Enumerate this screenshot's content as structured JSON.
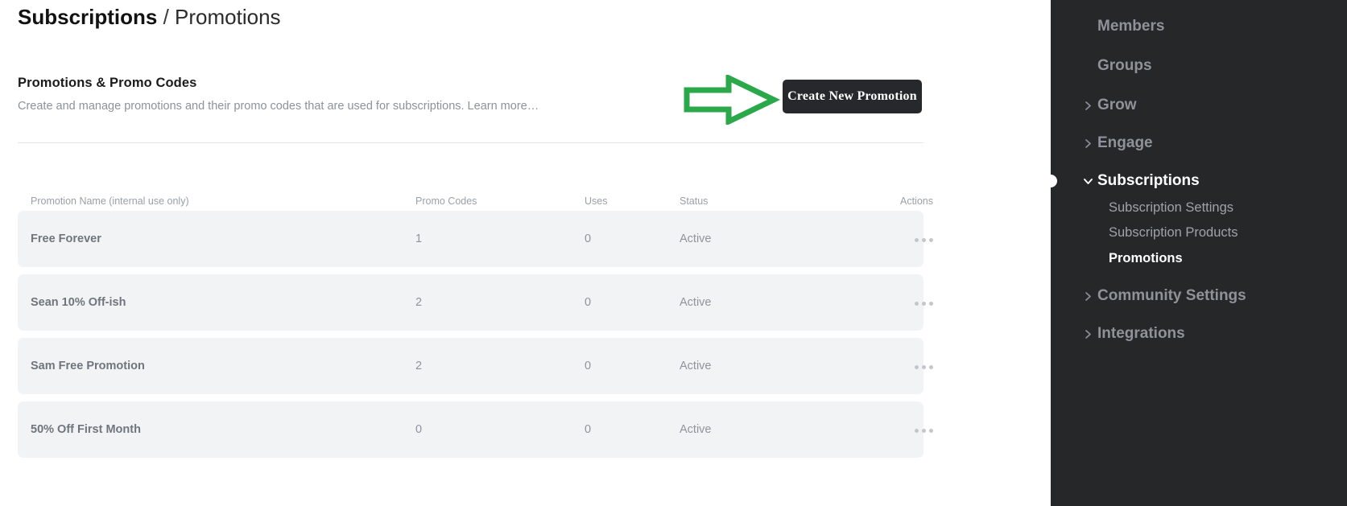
{
  "breadcrumb": {
    "parent": "Subscriptions",
    "separator": " / ",
    "current": "Promotions"
  },
  "section": {
    "title": "Promotions & Promo Codes",
    "subtitle": "Create and manage promotions and their promo codes that are used for subscriptions. Learn more…",
    "create_button_label": "Create New Promotion"
  },
  "annotation": {
    "type": "arrow-right",
    "color": "#2aa84a",
    "points_to": "create-new-promotion-button"
  },
  "table": {
    "headers": {
      "name": "Promotion Name (internal use only)",
      "promo_codes": "Promo Codes",
      "uses": "Uses",
      "status": "Status",
      "actions": "Actions"
    },
    "rows": [
      {
        "name": "Free Forever",
        "promo_codes": "1",
        "uses": "0",
        "status": "Active"
      },
      {
        "name": "Sean 10% Off-ish",
        "promo_codes": "2",
        "uses": "0",
        "status": "Active"
      },
      {
        "name": "Sam Free Promotion",
        "promo_codes": "2",
        "uses": "0",
        "status": "Active"
      },
      {
        "name": "50% Off First Month",
        "promo_codes": "0",
        "uses": "0",
        "status": "Active"
      }
    ]
  },
  "sidebar": {
    "items": [
      {
        "label": "Members",
        "chevron": "none",
        "active": false
      },
      {
        "label": "Groups",
        "chevron": "none",
        "active": false
      },
      {
        "label": "Grow",
        "chevron": "right",
        "active": false
      },
      {
        "label": "Engage",
        "chevron": "right",
        "active": false
      },
      {
        "label": "Subscriptions",
        "chevron": "down",
        "active": true
      },
      {
        "label": "Community Settings",
        "chevron": "right",
        "active": false
      },
      {
        "label": "Integrations",
        "chevron": "right",
        "active": false
      }
    ],
    "sub_items": [
      {
        "label": "Subscription Settings",
        "current": false
      },
      {
        "label": "Subscription Products",
        "current": false
      },
      {
        "label": "Promotions",
        "current": true
      }
    ]
  },
  "colors": {
    "sidebar_bg": "#262729",
    "button_bg": "#26282b",
    "row_bg": "#f2f3f5",
    "annotation_green": "#2aa84a"
  }
}
